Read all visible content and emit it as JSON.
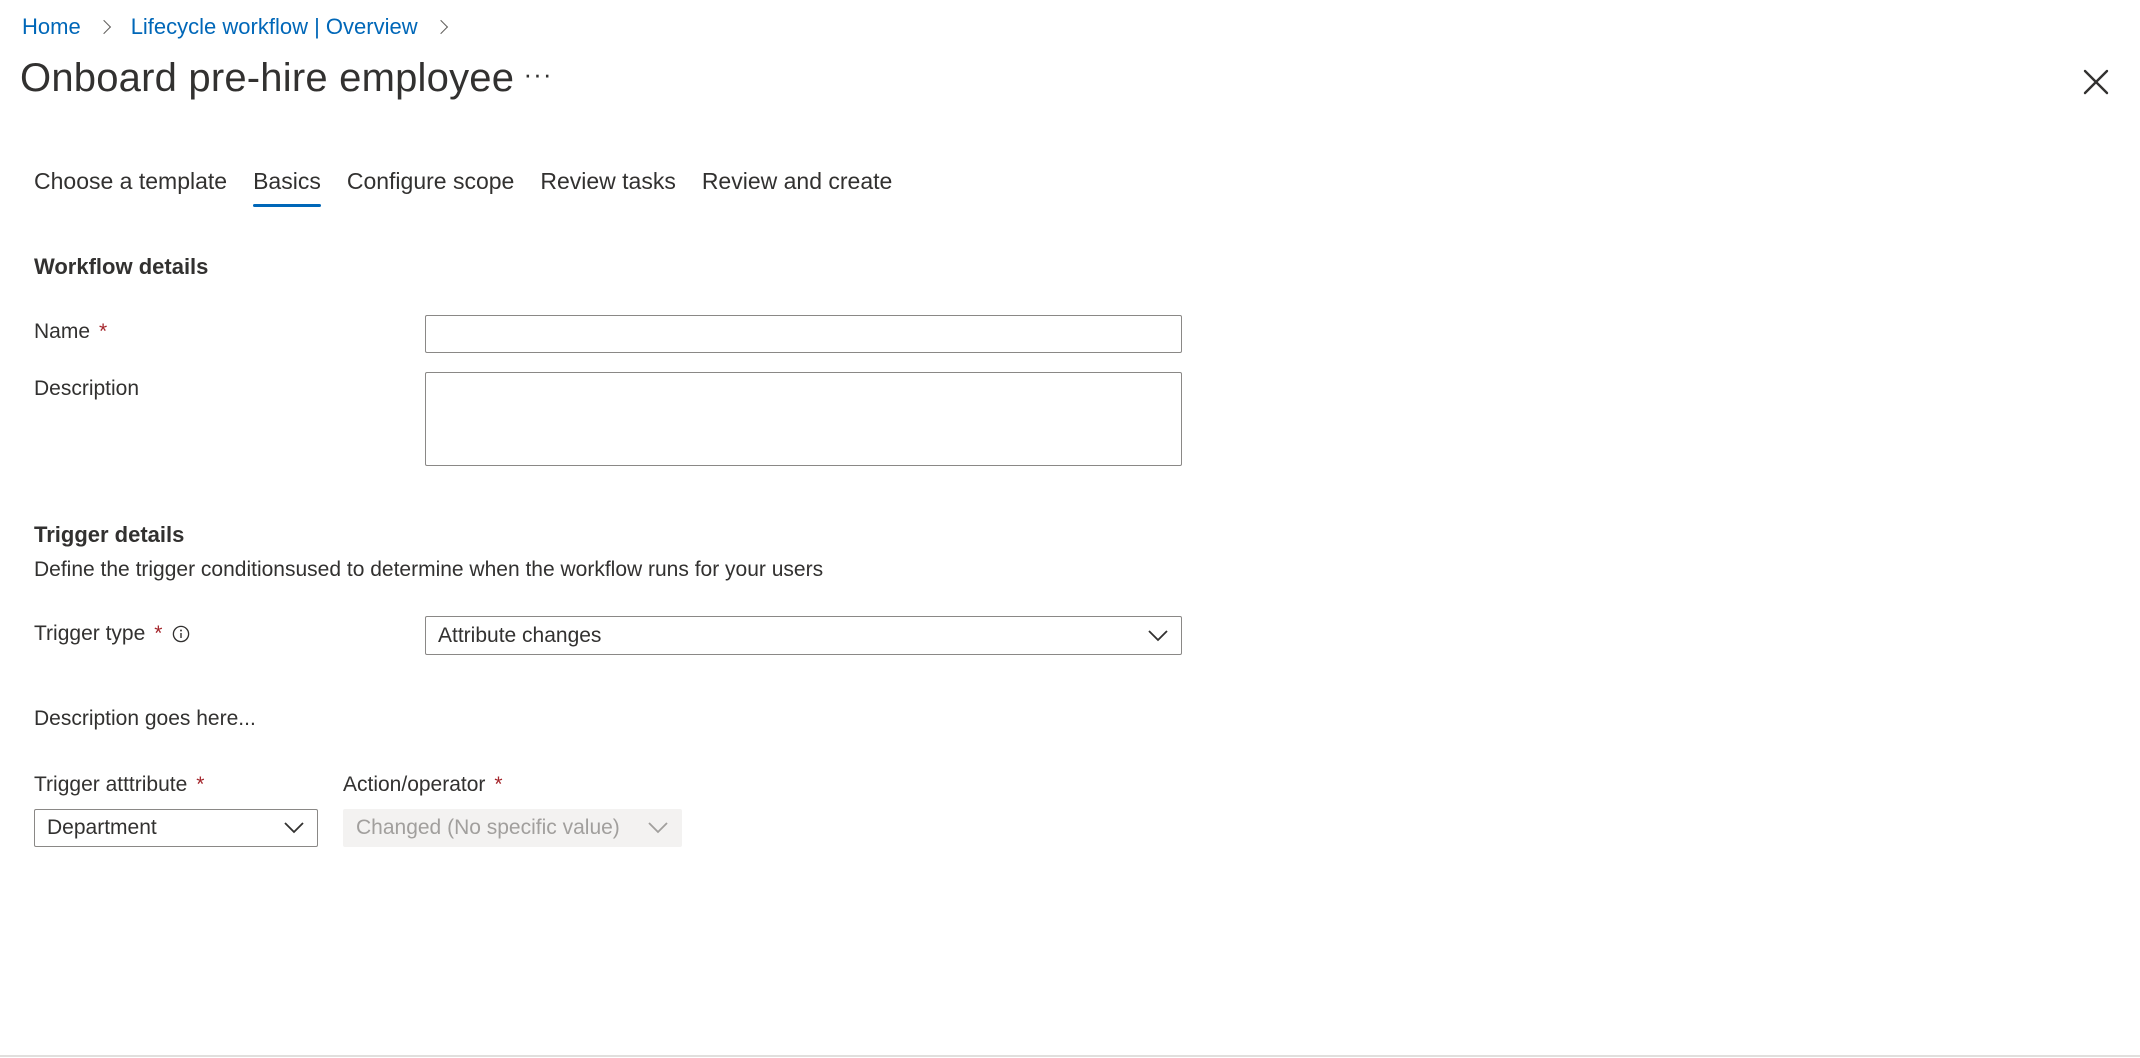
{
  "breadcrumb": {
    "items": [
      "Home",
      "Lifecycle workflow | Overview"
    ]
  },
  "page": {
    "title": "Onboard pre-hire employee",
    "more_label": "···"
  },
  "tabs": [
    {
      "label": "Choose a template",
      "active": false
    },
    {
      "label": "Basics",
      "active": true
    },
    {
      "label": "Configure scope",
      "active": false
    },
    {
      "label": "Review tasks",
      "active": false
    },
    {
      "label": "Review and create",
      "active": false
    }
  ],
  "workflow_details": {
    "title": "Workflow details",
    "name_label": "Name",
    "name_value": "",
    "description_label": "Description",
    "description_value": ""
  },
  "trigger_details": {
    "title": "Trigger details",
    "subtitle": "Define the trigger conditionsused to determine when the workflow runs for your users",
    "trigger_type_label": "Trigger type",
    "trigger_type_value": "Attribute changes",
    "description_text": "Description goes here...",
    "trigger_attribute_label": "Trigger atttribute",
    "trigger_attribute_value": "Department",
    "action_operator_label": "Action/operator",
    "action_operator_value": "Changed (No specific value)"
  },
  "required_mark": "*",
  "colors": {
    "accent": "#0067b8",
    "required": "#a4262c",
    "text": "#323130",
    "disabled_bg": "#f3f2f1",
    "disabled_text": "#a19f9d"
  },
  "icons": {
    "breadcrumb_separator": "chevron-right-icon",
    "close": "close-icon",
    "info": "info-icon",
    "dropdown": "chevron-down-icon"
  }
}
